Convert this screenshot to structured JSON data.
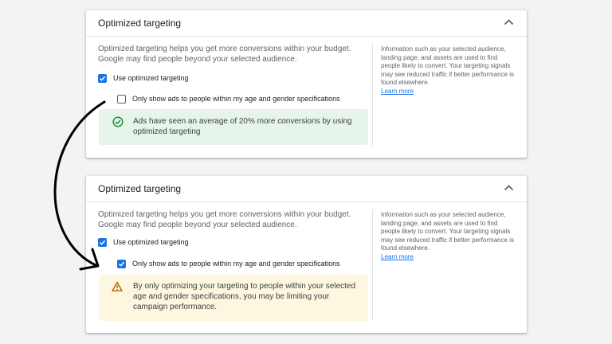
{
  "panels": [
    {
      "title": "Optimized targeting",
      "description": "Optimized targeting helps you get more conversions within your budget. Google may find people beyond your selected audience.",
      "use_optimized_label": "Use optimized targeting",
      "use_optimized_checked": true,
      "only_show_label": "Only show ads to people within my age and gender specifications",
      "only_show_checked": false,
      "notice_type": "success",
      "notice_icon": "check-circle-icon",
      "notice_text": "Ads have seen an average of 20% more conversions by using optimized targeting",
      "info_text": "Information such as your selected audience, landing page, and assets are used to find people likely to convert. Your targeting signals may see reduced traffic if better performance is found elsewhere.",
      "learn_more": "Learn more"
    },
    {
      "title": "Optimized targeting",
      "description": "Optimized targeting helps you get more conversions within your budget. Google may find people beyond your selected audience.",
      "use_optimized_label": "Use optimized targeting",
      "use_optimized_checked": true,
      "only_show_label": "Only show ads to people within my age and gender specifications",
      "only_show_checked": true,
      "notice_type": "warning",
      "notice_icon": "warning-icon",
      "notice_text": "By only optimizing your targeting to people within your selected age and gender specifications, you may be limiting your campaign performance.",
      "info_text": "Information such as your selected audience, landing page, and assets are used to find people likely to convert. Your targeting signals may see reduced traffic if better performance is found elsewhere.",
      "learn_more": "Learn more"
    }
  ],
  "colors": {
    "checkbox_blue": "#1a73e8",
    "success_bg": "#e6f4ea",
    "success_icon": "#1e8e3e",
    "warning_bg": "#fef7e0",
    "warning_icon": "#b06000",
    "link": "#1a73e8"
  },
  "annotation": {
    "icon": "curved-arrow-icon"
  }
}
